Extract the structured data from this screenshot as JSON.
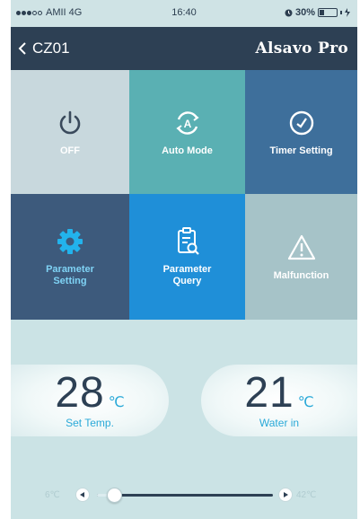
{
  "status_bar": {
    "carrier": "AMII 4G",
    "time": "16:40",
    "battery": "30%",
    "battery_level": 0.3
  },
  "header": {
    "back_label": "CZ01",
    "brand": "Alsavo Pro"
  },
  "tiles": [
    {
      "label": "OFF",
      "icon": "power-icon",
      "color": "#c8d8dd"
    },
    {
      "label": "Auto Mode",
      "icon": "auto-mode-icon",
      "color": "#5ab0b3"
    },
    {
      "label": "Timer Setting",
      "icon": "clock-icon",
      "color": "#3e6f9b"
    },
    {
      "label": "Parameter\nSetting",
      "icon": "gear-icon",
      "color": "#3d5a7c"
    },
    {
      "label": "Parameter\nQuery",
      "icon": "clipboard-search-icon",
      "color": "#1f8fd8"
    },
    {
      "label": "Malfunction",
      "icon": "warning-icon",
      "color": "#a6c3c8"
    }
  ],
  "set_temp": {
    "value": "28",
    "unit": "℃",
    "label": "Set Temp."
  },
  "water_in": {
    "value": "21",
    "unit": "℃",
    "label": "Water in"
  },
  "slider": {
    "min_label": "6℃",
    "max_label": "42℃",
    "min": 6,
    "max": 42,
    "value": 9.5
  }
}
